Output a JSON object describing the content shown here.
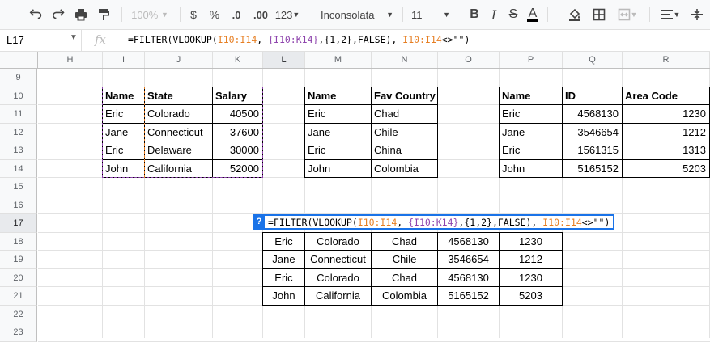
{
  "toolbar": {
    "zoom": "100%",
    "currency": "$",
    "percent": "%",
    "dec_less": ".0",
    "dec_more": ".00",
    "number_format": "123",
    "font_family": "Inconsolata",
    "font_size": "11"
  },
  "formula_bar": {
    "cell_ref": "L17",
    "fx": "fx",
    "parts": [
      {
        "text": "=FILTER(VLOOKUP(",
        "color": "#000000"
      },
      {
        "text": "I10:I14",
        "color": "#e67e22"
      },
      {
        "text": ", ",
        "color": "#000000"
      },
      {
        "text": "{I10:K14}",
        "color": "#8e44ad"
      },
      {
        "text": ",{1,2},FALSE), ",
        "color": "#000000"
      },
      {
        "text": "I10:I14",
        "color": "#e67e22"
      },
      {
        "text": "<>\"\")",
        "color": "#000000"
      }
    ]
  },
  "columns": [
    "H",
    "I",
    "J",
    "K",
    "L",
    "M",
    "N",
    "O",
    "P",
    "Q",
    "R"
  ],
  "rows": [
    "9",
    "10",
    "11",
    "12",
    "13",
    "14",
    "15",
    "16",
    "17",
    "18",
    "19",
    "20",
    "21",
    "22",
    "23"
  ],
  "selected_column": "L",
  "selected_row": "17",
  "table1": {
    "headers": [
      "Name",
      "State",
      "Salary"
    ],
    "rows": [
      [
        "Eric",
        "Colorado",
        "40500"
      ],
      [
        "Jane",
        "Connecticut",
        "37600"
      ],
      [
        "Eric",
        "Delaware",
        "30000"
      ],
      [
        "John",
        "California",
        "52000"
      ]
    ]
  },
  "table2": {
    "headers": [
      "Name",
      "Fav Country"
    ],
    "rows": [
      [
        "Eric",
        "Chad"
      ],
      [
        "Jane",
        "Chile"
      ],
      [
        "Eric",
        "China"
      ],
      [
        "John",
        "Colombia"
      ]
    ]
  },
  "table3": {
    "headers": [
      "Name",
      "ID",
      "Area Code"
    ],
    "rows": [
      [
        "Eric",
        "4568130",
        "1230"
      ],
      [
        "Jane",
        "3546654",
        "1212"
      ],
      [
        "Eric",
        "1561315",
        "1313"
      ],
      [
        "John",
        "5165152",
        "5203"
      ]
    ]
  },
  "editor": {
    "help": "?"
  },
  "result": {
    "rows": [
      [
        "Eric",
        "Colorado",
        "Chad",
        "4568130",
        "1230"
      ],
      [
        "Jane",
        "Connecticut",
        "Chile",
        "3546654",
        "1212"
      ],
      [
        "Eric",
        "Colorado",
        "Chad",
        "4568130",
        "1230"
      ],
      [
        "John",
        "California",
        "Colombia",
        "5165152",
        "5203"
      ]
    ]
  },
  "colors": {
    "selection_blue": "#1a73e8",
    "range_purple": "#8e44ad",
    "range_orange": "#e67e22"
  }
}
